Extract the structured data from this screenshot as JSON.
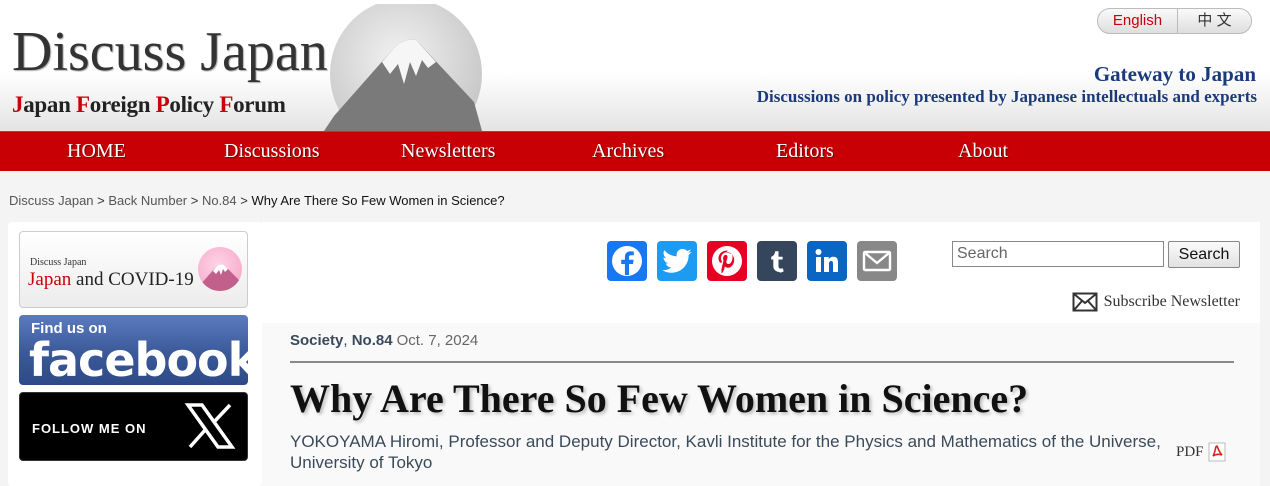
{
  "header": {
    "logo_title": "Discuss Japan",
    "logo_sub": [
      {
        "ini": "J",
        "rest": "apan "
      },
      {
        "ini": "F",
        "rest": "oreign "
      },
      {
        "ini": "P",
        "rest": "olicy "
      },
      {
        "ini": "F",
        "rest": "orum"
      }
    ],
    "lang_en": "English",
    "lang_zh": "中 文",
    "gateway": "Gateway to Japan",
    "tagline": "Discussions on policy presented by Japanese intellectuals and experts"
  },
  "nav": [
    "HOME",
    "Discussions",
    "Newsletters",
    "Archives",
    "Editors",
    "About"
  ],
  "breadcrumb": {
    "links": [
      "Discuss Japan",
      "Back Number",
      "No.84"
    ],
    "separator": " > ",
    "current": "Why Are There So Few Women in Science?"
  },
  "sidebar": {
    "covid_small": "Discuss Japan",
    "covid_title_red": "Japan",
    "covid_title_rest": " and COVID-19",
    "fb_find": "Find us on",
    "fb_big": "facebook",
    "x_follow": "FOLLOW ME ON"
  },
  "share": [
    {
      "name": "facebook",
      "color": "#1877f2"
    },
    {
      "name": "twitter",
      "color": "#1d9bf0"
    },
    {
      "name": "pinterest",
      "color": "#e60023"
    },
    {
      "name": "tumblr",
      "color": "#35465c"
    },
    {
      "name": "linkedin",
      "color": "#0a66c2"
    },
    {
      "name": "email",
      "color": "#888888"
    }
  ],
  "search": {
    "placeholder": "Search",
    "button": "Search"
  },
  "subscribe": "Subscribe Newsletter",
  "article": {
    "category": "Society",
    "comma": ", ",
    "issue": "No.84",
    "date": "Oct. 7, 2024",
    "title": "Why Are There So Few Women in Science?",
    "author": "YOKOYAMA Hiromi, Professor and Deputy Director, Kavli Institute for the Physics and Mathematics of the Universe, University of Tokyo",
    "pdf": "PDF"
  },
  "colors": {
    "nav_bg": "#c80006",
    "brand_red": "#c8000a",
    "brand_navy": "#1a3a7a"
  }
}
